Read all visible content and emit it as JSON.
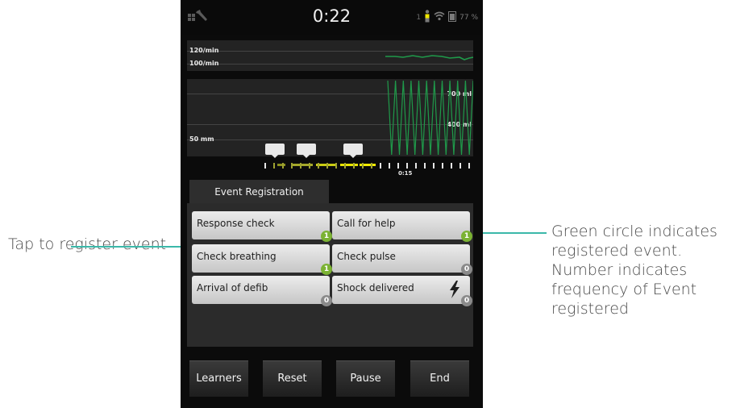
{
  "status": {
    "time": "0:22",
    "user_count": "1",
    "battery": "77 %"
  },
  "rate_chart": {
    "label_high": "120/min",
    "label_low": "100/min"
  },
  "depth_chart": {
    "label_depth": "50 mm",
    "label_vol_high": "700 ml",
    "label_vol_low": "400 ml"
  },
  "timeline": {
    "time_label": "0:15"
  },
  "event_registration": {
    "tab_label": "Event Registration",
    "events": [
      {
        "label": "Response check",
        "count": "1",
        "registered": true
      },
      {
        "label": "Call for help",
        "count": "1",
        "registered": true
      },
      {
        "label": "Check breathing",
        "count": "1",
        "registered": true
      },
      {
        "label": "Check pulse",
        "count": "0",
        "registered": false
      },
      {
        "label": "Arrival of defib",
        "count": "0",
        "registered": false
      },
      {
        "label": "Shock delivered",
        "count": "0",
        "registered": false,
        "icon": "lightning-bolt-icon"
      }
    ]
  },
  "bottom_buttons": [
    "Learners",
    "Reset",
    "Pause",
    "End"
  ],
  "annotations": {
    "left": "Tap to register event",
    "right": "Green circle indicates registered event. Number indicates frequency of Event registered"
  },
  "colors": {
    "callout_line": "#3bb8a9",
    "badge_registered": "#7bb233",
    "badge_unregistered": "#8a8a8a",
    "waveform": "#1f9a4a",
    "timeline_marks": "#f0e800"
  }
}
